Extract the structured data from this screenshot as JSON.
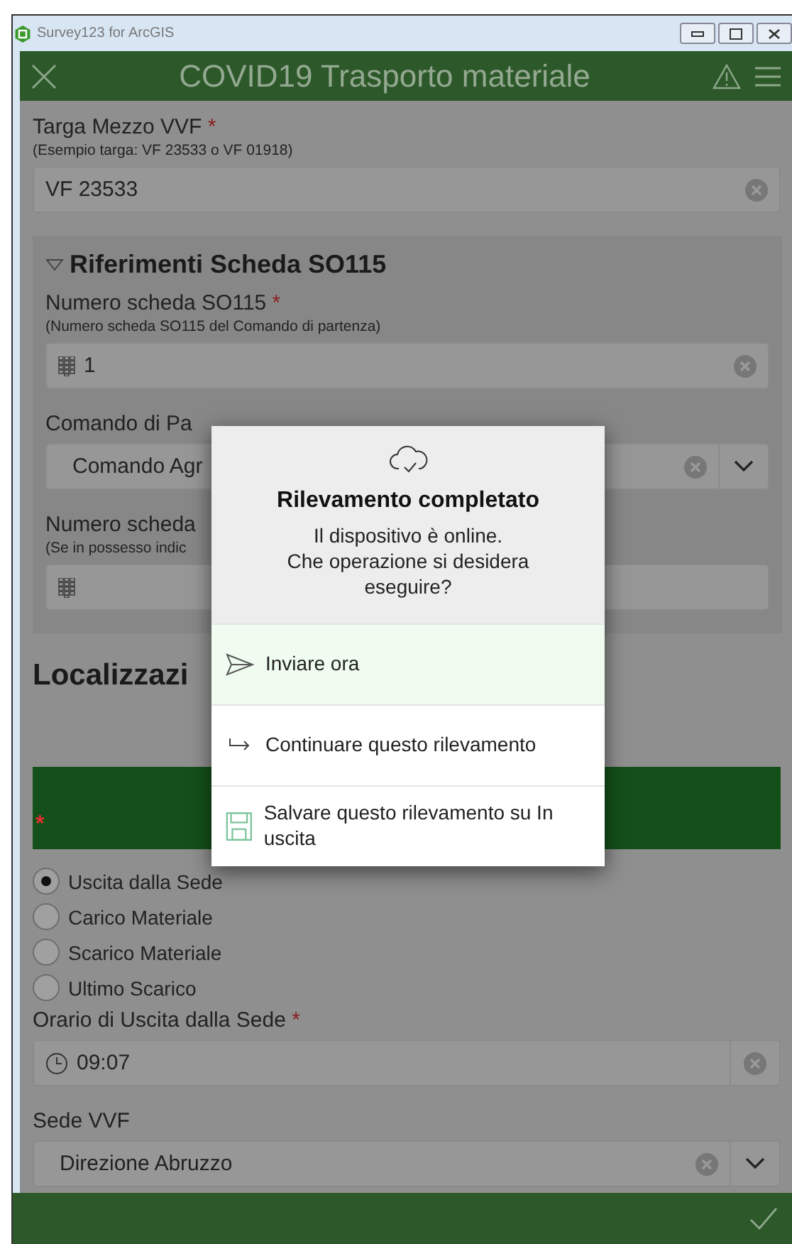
{
  "window": {
    "title": "Survey123 for ArcGIS"
  },
  "header": {
    "title": "COVID19 Trasporto materiale"
  },
  "form": {
    "fields": [
      {
        "kind": "text",
        "label": "Targa Mezzo VVF",
        "required": true,
        "hint": "(Esempio targa: VF 23533 o VF 01918)",
        "value": "VF 23533"
      }
    ],
    "group": {
      "title": "Riferimenti Scheda SO115",
      "expanded": true,
      "fields": [
        {
          "kind": "number",
          "label": "Numero scheda SO115",
          "required": true,
          "hint": "(Numero scheda SO115 del Comando di partenza)",
          "value": "1"
        },
        {
          "kind": "select",
          "label": "Comando di Pa",
          "required": false,
          "value": "Comando Agr"
        },
        {
          "kind": "number",
          "label": "Numero scheda",
          "required": false,
          "hint": "(Se in possesso indic"
        }
      ]
    },
    "section_title": "Localizzazi",
    "required_mark": "*",
    "radios": [
      {
        "label": "Uscita dalla Sede",
        "selected": true
      },
      {
        "label": "Carico Materiale",
        "selected": false
      },
      {
        "label": "Scarico Materiale",
        "selected": false
      },
      {
        "label": "Ultimo Scarico",
        "selected": false
      }
    ],
    "fields_after": [
      {
        "kind": "time",
        "label": "Orario di Uscita dalla Sede",
        "required": true,
        "value": "09:07"
      },
      {
        "kind": "select",
        "label": "Sede VVF",
        "required": false,
        "value": "Direzione Abruzzo"
      }
    ]
  },
  "dialog": {
    "title": "Rilevamento completato",
    "message": "Il dispositivo è online.\nChe operazione si desidera eseguire?",
    "options": [
      {
        "kind": "send",
        "label": "Inviare ora",
        "selected": true
      },
      {
        "kind": "continue",
        "label": "Continuare questo rilevamento",
        "selected": false
      },
      {
        "kind": "save",
        "label": "Salvare questo rilevamento su In uscita",
        "selected": false
      }
    ]
  }
}
